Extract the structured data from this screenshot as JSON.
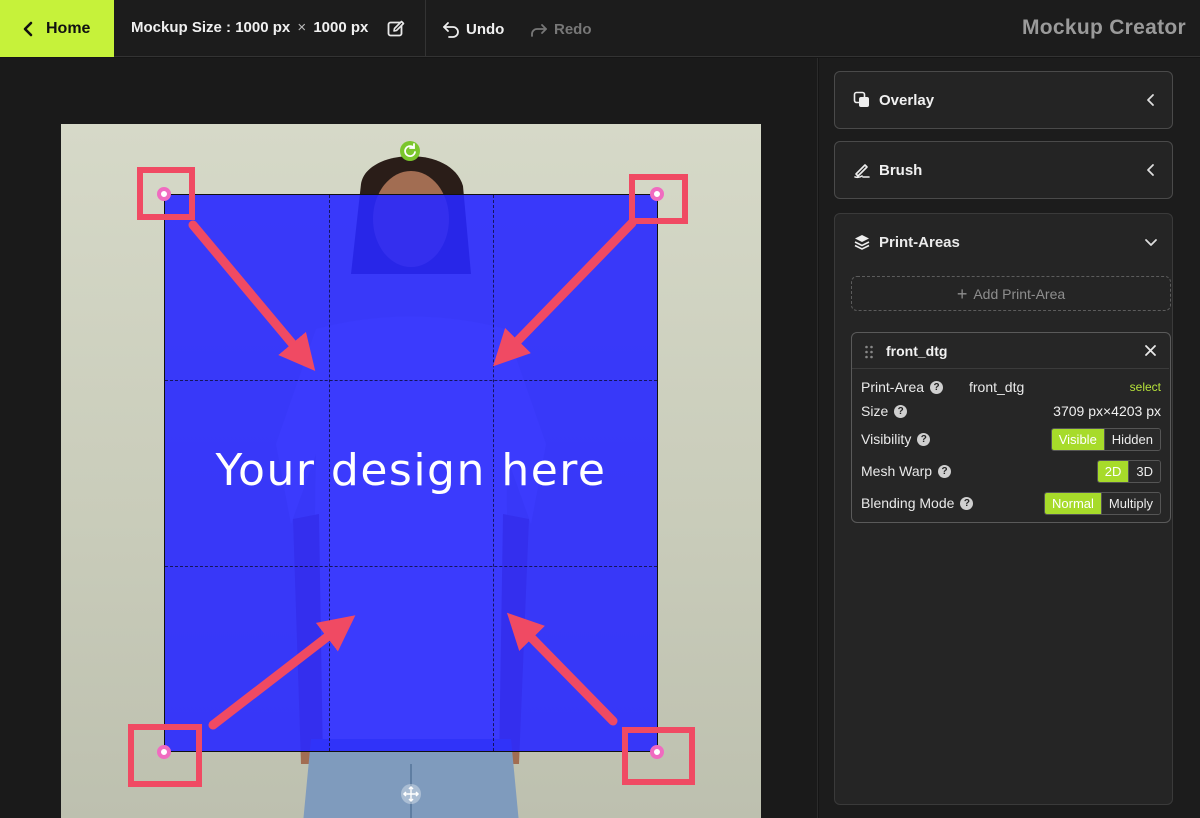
{
  "header": {
    "home_label": "Home",
    "mockup_size_label": "Mockup Size :",
    "width_value": "1000 px",
    "times": "×",
    "height_value": "1000 px",
    "undo_label": "Undo",
    "redo_label": "Redo",
    "app_title": "Mockup Creator"
  },
  "canvas": {
    "design_placeholder": "Your design here",
    "print_area_color": "#2828ff",
    "annotation_color": "#f04a63"
  },
  "panel": {
    "overlay_label": "Overlay",
    "brush_label": "Brush",
    "print_areas_label": "Print-Areas",
    "add_print_area_label": "Add Print-Area",
    "card": {
      "name": "front_dtg",
      "print_area_label": "Print-Area",
      "print_area_value": "front_dtg",
      "select_label": "select",
      "size_label": "Size",
      "size_value": "3709 px×4203 px",
      "visibility_label": "Visibility",
      "visibility_options": [
        "Visible",
        "Hidden"
      ],
      "visibility_selected": "Visible",
      "mesh_warp_label": "Mesh Warp",
      "mesh_warp_options": [
        "2D",
        "3D"
      ],
      "mesh_warp_selected": "2D",
      "blending_label": "Blending Mode",
      "blending_options": [
        "Normal",
        "Multiply"
      ],
      "blending_selected": "Normal"
    }
  }
}
